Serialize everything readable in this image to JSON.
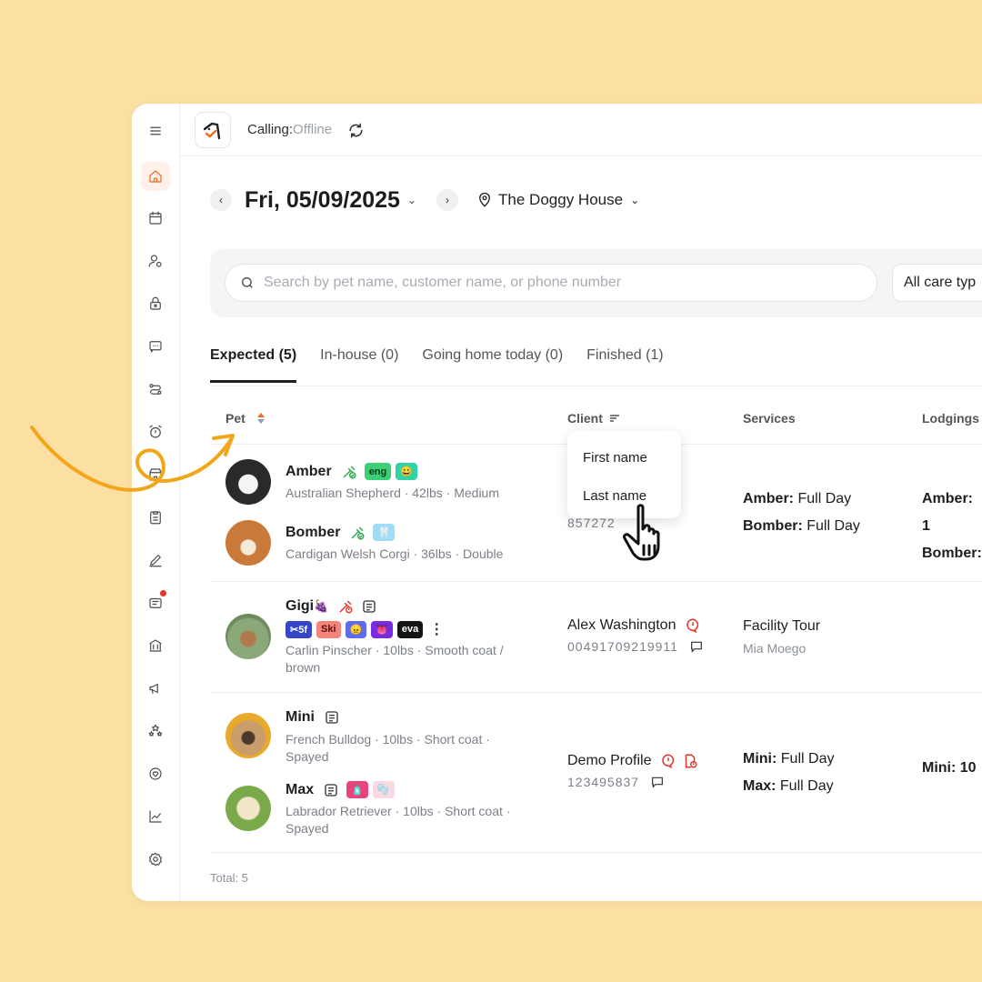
{
  "header": {
    "calling_label": "Calling:",
    "calling_status": "Offline"
  },
  "date_row": {
    "date": "Fri, 05/09/2025",
    "location": "The Doggy House"
  },
  "filters": {
    "search_placeholder": "Search by pet name, customer name, or phone number",
    "care_type": "All care typ"
  },
  "tabs": [
    {
      "label": "Expected (5)",
      "active": true
    },
    {
      "label": "In-house (0)",
      "active": false
    },
    {
      "label": "Going home today (0)",
      "active": false
    },
    {
      "label": "Finished (1)",
      "active": false
    }
  ],
  "columns": {
    "pet": "Pet",
    "client": "Client",
    "services": "Services",
    "lodgings": "Lodgings"
  },
  "client_dropdown": {
    "first": "First name",
    "last": "Last name"
  },
  "rows": [
    {
      "pets": [
        {
          "name": "Amber",
          "desc": "Australian Shepherd · 42lbs · Medium",
          "tags": [
            "eng",
            "😀"
          ]
        },
        {
          "name": "Bomber",
          "desc": "Cardigan Welsh Corgi · 36lbs · Double",
          "tags": [
            "🦷"
          ]
        }
      ],
      "client": {
        "phone": "857272"
      },
      "services": [
        {
          "pet": "Amber:",
          "service": "Full Day"
        },
        {
          "pet": "Bomber:",
          "service": "Full Day"
        }
      ],
      "lodgings": [
        "Amber: 1",
        "Bomber:"
      ]
    },
    {
      "pets": [
        {
          "name": "Gigi",
          "emoji": "🍇",
          "desc_line1": "Carlin Pinscher · 10lbs · Smooth coat /",
          "desc_line2": "brown",
          "tags": [
            "✂5f",
            "Ski",
            "😠",
            "👅",
            "eva"
          ]
        }
      ],
      "client": {
        "name": "Alex Washington",
        "phone": "00491709219911"
      },
      "services": [
        {
          "service": "Facility Tour",
          "staff": "Mia Moego"
        }
      ]
    },
    {
      "pets": [
        {
          "name": "Mini",
          "desc_line1": "French Bulldog · 10lbs · Short coat ·",
          "desc_line2": "Spayed"
        },
        {
          "name": "Max",
          "desc_line1": "Labrador Retriever · 10lbs · Short coat ·",
          "desc_line2": "Spayed",
          "tags": [
            "🧴",
            "🫧"
          ]
        }
      ],
      "client": {
        "name": "Demo Profile",
        "phone": "123495837"
      },
      "services": [
        {
          "pet": "Mini:",
          "service": "Full Day"
        },
        {
          "pet": "Max:",
          "service": "Full Day"
        }
      ],
      "lodgings": [
        "Mini: 10"
      ]
    }
  ],
  "footer": {
    "total": "Total: 5"
  },
  "colors": {
    "accent": "#f06b1e",
    "background": "#FCDFA3",
    "arrow": "#F2A71B"
  }
}
